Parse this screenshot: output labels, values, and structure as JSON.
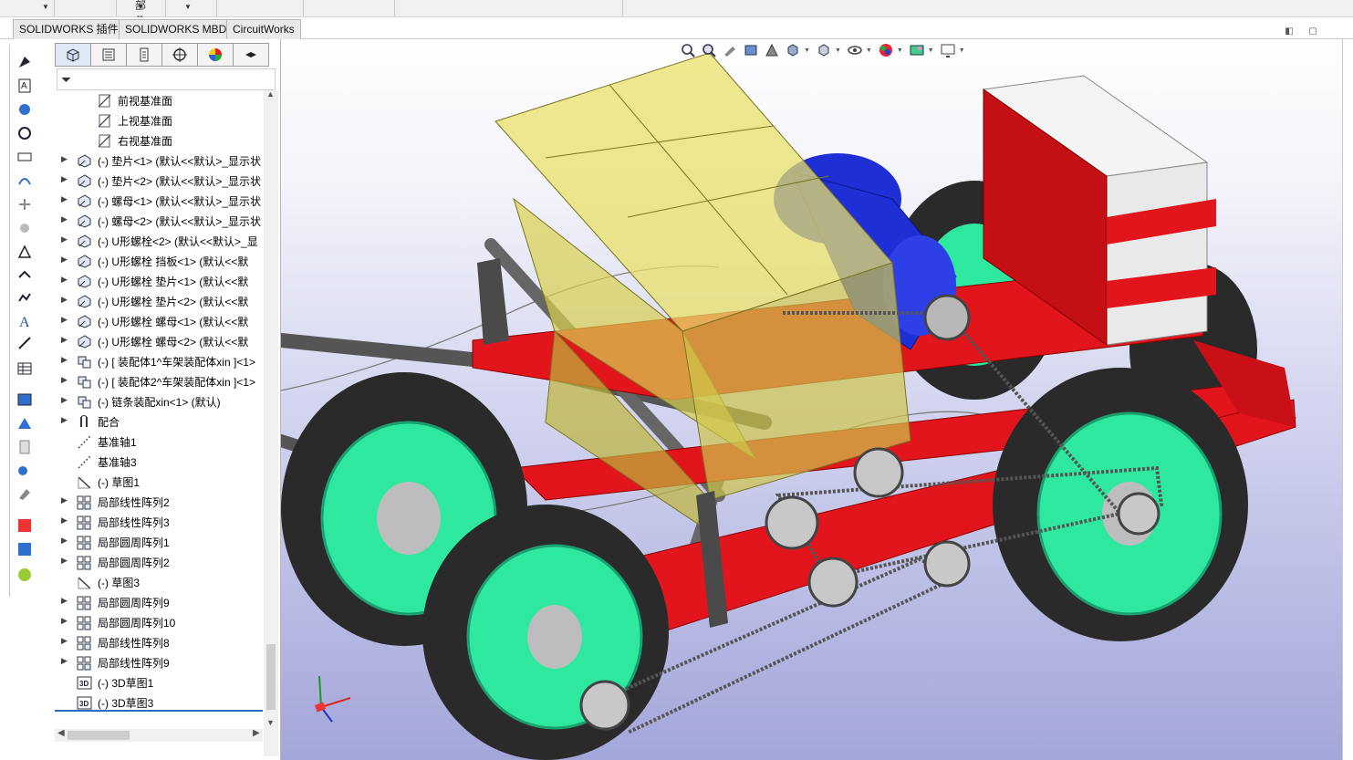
{
  "top_strip": {
    "partial_label": "部件"
  },
  "command_tabs": [
    "SOLIDWORKS 插件",
    "SOLIDWORKS MBD",
    "CircuitWorks"
  ],
  "feature_manager": {
    "tabs": [
      "featuremanager-tab",
      "propertymanager-tab",
      "configurationmanager-tab",
      "dimxpert-tab",
      "display-manager-tab",
      "extra-tab"
    ],
    "filter_icon": "filter-icon",
    "tree": [
      {
        "label": "前视基准面",
        "icon": "plane-icon",
        "expandable": false,
        "indent": 1
      },
      {
        "label": "上视基准面",
        "icon": "plane-icon",
        "expandable": false,
        "indent": 1
      },
      {
        "label": "右视基准面",
        "icon": "plane-icon",
        "expandable": false,
        "indent": 1
      },
      {
        "label": "(-) 垫片<1> (默认<<默认>_显示状",
        "icon": "part-icon",
        "expandable": true,
        "indent": 0
      },
      {
        "label": "(-) 垫片<2> (默认<<默认>_显示状",
        "icon": "part-icon",
        "expandable": true,
        "indent": 0
      },
      {
        "label": "(-) 螺母<1> (默认<<默认>_显示状",
        "icon": "part-icon",
        "expandable": true,
        "indent": 0
      },
      {
        "label": "(-) 螺母<2> (默认<<默认>_显示状",
        "icon": "part-icon",
        "expandable": true,
        "indent": 0
      },
      {
        "label": "(-) U形螺栓<2> (默认<<默认>_显",
        "icon": "part-icon",
        "expandable": true,
        "indent": 0
      },
      {
        "label": "(-) U形螺栓 挡板<1> (默认<<默",
        "icon": "part-icon",
        "expandable": true,
        "indent": 0
      },
      {
        "label": "(-) U形螺栓 垫片<1> (默认<<默",
        "icon": "part-icon",
        "expandable": true,
        "indent": 0
      },
      {
        "label": "(-) U形螺栓 垫片<2> (默认<<默",
        "icon": "part-icon",
        "expandable": true,
        "indent": 0
      },
      {
        "label": "(-) U形螺栓 螺母<1> (默认<<默",
        "icon": "part-icon",
        "expandable": true,
        "indent": 0
      },
      {
        "label": "(-) U形螺栓 螺母<2> (默认<<默",
        "icon": "part-icon",
        "expandable": true,
        "indent": 0
      },
      {
        "label": "(-) [ 装配体1^车架装配体xin ]<1>",
        "icon": "assembly-icon",
        "expandable": true,
        "indent": 0
      },
      {
        "label": "(-) [ 装配体2^车架装配体xin ]<1>",
        "icon": "assembly-icon",
        "expandable": true,
        "indent": 0
      },
      {
        "label": "(-) 链条装配xin<1> (默认)",
        "icon": "assembly-icon",
        "expandable": true,
        "indent": 0
      },
      {
        "label": "配合",
        "icon": "mates-icon",
        "expandable": true,
        "indent": 0
      },
      {
        "label": "基准轴1",
        "icon": "axis-icon",
        "expandable": false,
        "indent": 0
      },
      {
        "label": "基准轴3",
        "icon": "axis-icon",
        "expandable": false,
        "indent": 0
      },
      {
        "label": "(-) 草图1",
        "icon": "sketch-icon",
        "expandable": false,
        "indent": 0
      },
      {
        "label": "局部线性阵列2",
        "icon": "pattern-icon",
        "expandable": true,
        "indent": 0
      },
      {
        "label": "局部线性阵列3",
        "icon": "pattern-icon",
        "expandable": true,
        "indent": 0
      },
      {
        "label": "局部圆周阵列1",
        "icon": "pattern-icon",
        "expandable": true,
        "indent": 0
      },
      {
        "label": "局部圆周阵列2",
        "icon": "pattern-icon",
        "expandable": true,
        "indent": 0
      },
      {
        "label": "(-) 草图3",
        "icon": "sketch-icon",
        "expandable": false,
        "indent": 0
      },
      {
        "label": "局部圆周阵列9",
        "icon": "pattern-icon",
        "expandable": true,
        "indent": 0
      },
      {
        "label": "局部圆周阵列10",
        "icon": "pattern-icon",
        "expandable": true,
        "indent": 0
      },
      {
        "label": "局部线性阵列8",
        "icon": "pattern-icon",
        "expandable": true,
        "indent": 0
      },
      {
        "label": "局部线性阵列9",
        "icon": "pattern-icon",
        "expandable": true,
        "indent": 0
      },
      {
        "label": "(-) 3D草图1",
        "icon": "sketch3d-icon",
        "expandable": false,
        "indent": 0
      },
      {
        "label": "(-) 3D草图3",
        "icon": "sketch3d-icon",
        "expandable": false,
        "indent": 0
      }
    ]
  },
  "left_toolbar_icons": [
    "smart-fastener-icon",
    "note-icon",
    "balloon-icon",
    "auto-balloon-icon",
    "bom-icon",
    "magnetic-line-icon",
    "datum-icon",
    "datum-target-icon",
    "surface-finish-icon",
    "weld-symbol-icon",
    "center-mark-icon",
    "text-icon",
    "hole-callout-icon",
    "table-icon",
    "3d-view-icon",
    "section-view-icon",
    "explode-icon",
    "render-icon",
    "instant3d-icon",
    "publish-pdf-icon",
    "3d-pdf-icon",
    "edrawings-icon"
  ],
  "heads_up_icons": [
    "zoom-to-fit-icon",
    "zoom-to-area-icon",
    "previous-view-icon",
    "section-view-icon",
    "dynamic-annotation-icon",
    "view-orientation-icon",
    "display-style-icon",
    "hide-show-icon",
    "edit-appearance-icon",
    "apply-scene-icon",
    "view-settings-icon"
  ],
  "colors": {
    "frame_red": "#e2151c",
    "wheel_green": "#2ee8a0",
    "hopper_yellow": "#e8e06a",
    "motor_blue": "#1f2fd6",
    "tire_dark": "#2a2a2a",
    "box_white": "#f4f4f4"
  }
}
